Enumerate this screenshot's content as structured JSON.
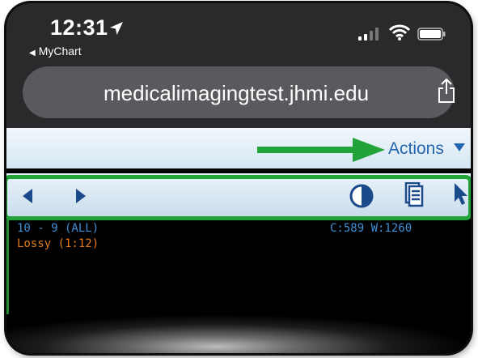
{
  "status_bar": {
    "time": "12:31",
    "back_app": "MyChart"
  },
  "browser": {
    "url": "medicalimagingtest.jhmi.edu"
  },
  "header": {
    "actions_label": "Actions"
  },
  "toolbar": {
    "buttons": [
      "previous-icon",
      "next-icon",
      "contrast-icon",
      "series-icon",
      "pointer-icon"
    ]
  },
  "viewer": {
    "series_label": "10 - 9 (ALL)",
    "compression_label": "Lossy (1:12)",
    "window_level": "C:589 W:1260"
  },
  "colors": {
    "highlight_green": "#22a33a",
    "link_blue": "#2566b0",
    "overlay_blue": "#3e8fd6",
    "overlay_orange": "#e07a1c"
  }
}
